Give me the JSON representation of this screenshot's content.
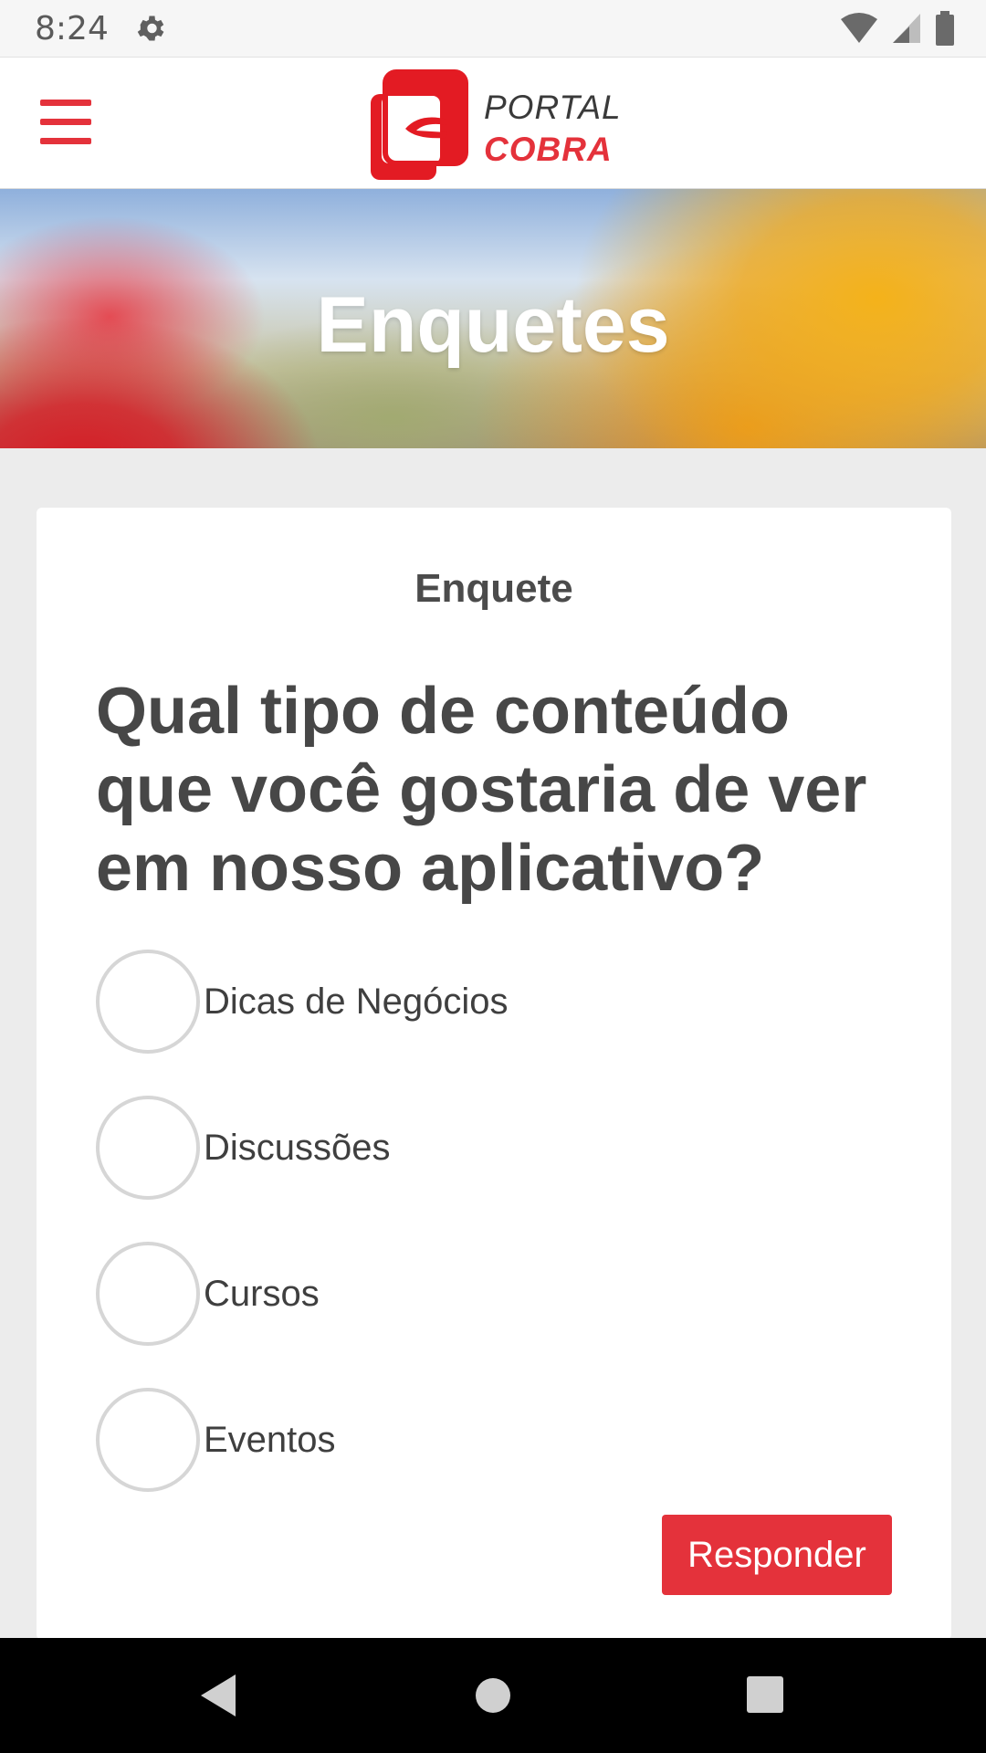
{
  "status_bar": {
    "time": "8:24"
  },
  "header": {
    "logo_word1": "PORTAL",
    "logo_word2": "COBRA",
    "brand_color": "#e4323b"
  },
  "hero": {
    "title": "Enquetes"
  },
  "poll": {
    "label": "Enquete",
    "question": "Qual tipo de conteúdo que você gostaria de ver em nosso aplicativo?",
    "options": [
      "Dicas de Negócios",
      "Discussões",
      "Cursos",
      "Eventos"
    ],
    "submit_label": "Responder"
  },
  "icons": {
    "status": [
      "gear-icon",
      "wifi-icon",
      "signal-icon",
      "battery-icon"
    ],
    "navigation": [
      "back-icon",
      "home-icon",
      "recents-icon"
    ]
  }
}
